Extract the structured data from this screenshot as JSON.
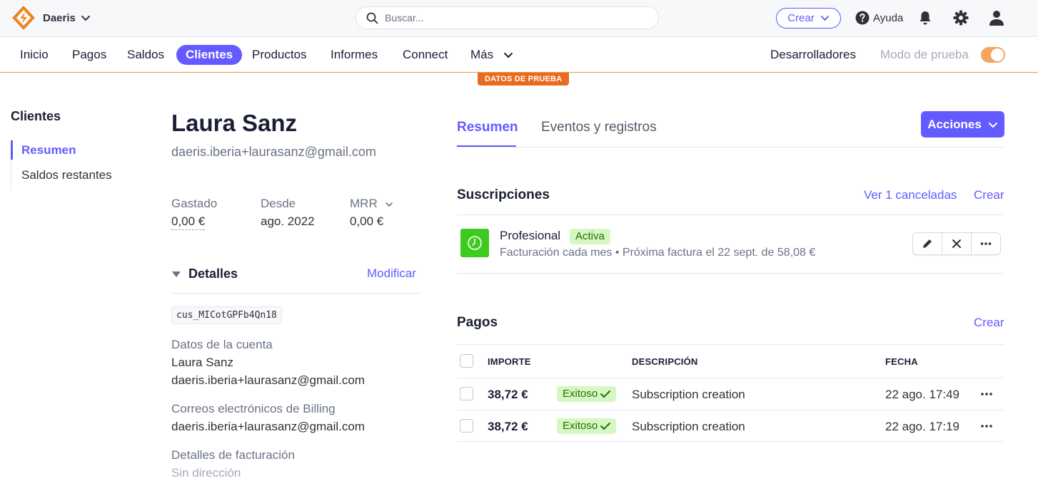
{
  "topbar": {
    "account_name": "Daeris",
    "search_placeholder": "Buscar...",
    "create_label": "Crear",
    "help_label": "Ayuda"
  },
  "nav": {
    "items": [
      "Inicio",
      "Pagos",
      "Saldos",
      "Clientes",
      "Productos",
      "Informes",
      "Connect",
      "Más"
    ],
    "active": "Clientes",
    "developers_label": "Desarrolladores",
    "test_mode_label": "Modo de prueba",
    "test_mode_on": true,
    "test_data_badge": "DATOS DE PRUEBA"
  },
  "sidebar": {
    "title": "Clientes",
    "items": [
      {
        "label": "Resumen",
        "active": true
      },
      {
        "label": "Saldos restantes",
        "active": false
      }
    ]
  },
  "customer": {
    "name": "Laura Sanz",
    "email": "daeris.iberia+laurasanz@gmail.com",
    "stats": [
      {
        "label": "Gastado",
        "value": "0,00 €"
      },
      {
        "label": "Desde",
        "value": "ago. 2022"
      },
      {
        "label": "MRR",
        "value": "0,00 €"
      }
    ],
    "details": {
      "title": "Detalles",
      "modify_label": "Modificar",
      "customer_id": "cus_MICotGPFb4Qn18",
      "account_label": "Datos de la cuenta",
      "account_name": "Laura Sanz",
      "account_email": "daeris.iberia+laurasanz@gmail.com",
      "billing_emails_label": "Correos electrónicos de Billing",
      "billing_email": "daeris.iberia+laurasanz@gmail.com",
      "billing_details_label": "Detalles de facturación",
      "billing_address": "Sin dirección"
    }
  },
  "tabs": [
    {
      "label": "Resumen",
      "active": true
    },
    {
      "label": "Eventos y registros",
      "active": false
    }
  ],
  "actions_label": "Acciones",
  "subscriptions": {
    "title": "Suscripciones",
    "view_canceled_label": "Ver 1 canceladas",
    "create_label": "Crear",
    "items": [
      {
        "name": "Profesional",
        "status": "Activa",
        "description": "Facturación cada mes • Próxima factura el 22 sept. de 58,08 €"
      }
    ]
  },
  "payments": {
    "title": "Pagos",
    "create_label": "Crear",
    "columns": [
      "IMPORTE",
      "DESCRIPCIÓN",
      "FECHA"
    ],
    "rows": [
      {
        "amount": "38,72 €",
        "status": "Exitoso",
        "description": "Subscription creation",
        "date": "22 ago. 17:49"
      },
      {
        "amount": "38,72 €",
        "status": "Exitoso",
        "description": "Subscription creation",
        "date": "22 ago. 17:19"
      }
    ]
  },
  "colors": {
    "accent": "#635bff",
    "test_orange": "#ea6a1f",
    "success_bg": "#d7f7c2",
    "success_text": "#217005",
    "subscription_icon": "#3ccb1e"
  }
}
